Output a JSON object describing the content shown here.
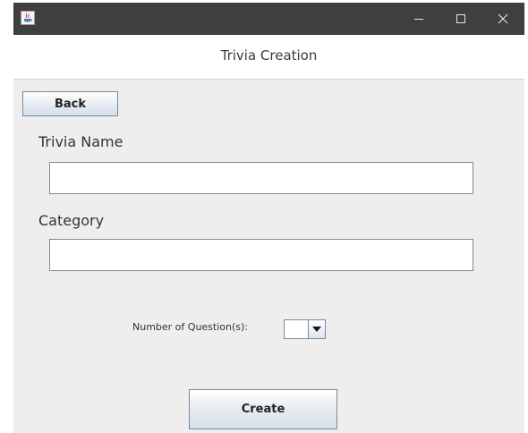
{
  "window": {
    "title": "",
    "app_icon": "java-icon",
    "controls": {
      "minimize_icon": "minimize-icon",
      "maximize_icon": "maximize-icon",
      "close_icon": "close-icon"
    }
  },
  "header": {
    "title": "Trivia Creation"
  },
  "toolbar": {
    "back_label": "Back"
  },
  "form": {
    "trivia_name": {
      "label": "Trivia Name",
      "value": "",
      "placeholder": ""
    },
    "category": {
      "label": "Category",
      "value": "",
      "placeholder": ""
    },
    "num_questions": {
      "label": "Number of Question(s):",
      "selected_value": "",
      "arrow_icon": "chevron-down-icon"
    },
    "create_label": "Create"
  },
  "colors": {
    "titlebar": "#3f3f3f",
    "panel_background": "#eeeeee",
    "header_background": "#ffffff",
    "border": "#7a8a99"
  }
}
